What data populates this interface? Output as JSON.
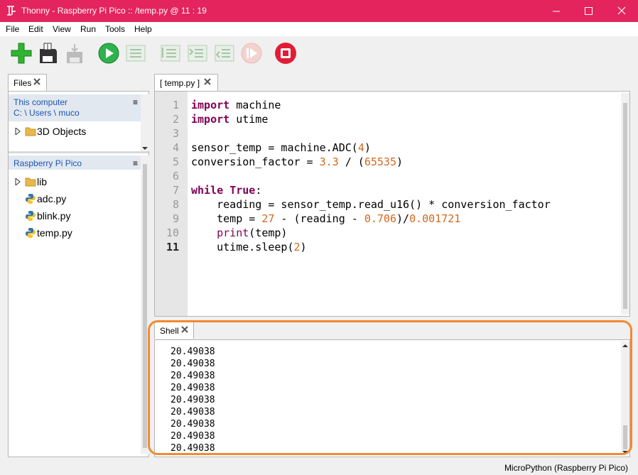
{
  "window": {
    "title": "Thonny  -  Raspberry Pi Pico :: /temp.py  @  11 : 19",
    "colors": {
      "titlebar": "#e3245d",
      "highlight": "#f28a30"
    }
  },
  "menu": [
    "File",
    "Edit",
    "View",
    "Run",
    "Tools",
    "Help"
  ],
  "toolbar": {
    "icons": [
      "new-file-icon",
      "save-icon",
      "load-icon",
      "run-icon",
      "debug-icon",
      "step-over-icon",
      "step-into-icon",
      "step-out-icon",
      "resume-icon",
      "stop-icon"
    ]
  },
  "files": {
    "tab_label": "Files",
    "this_computer": {
      "title": "This computer",
      "path": "C: \\ Users \\ muco",
      "items": [
        {
          "name": "3D Objects",
          "type": "folder"
        }
      ]
    },
    "pico": {
      "title": "Raspberry Pi Pico",
      "items": [
        {
          "name": "lib",
          "type": "folder"
        },
        {
          "name": "adc.py",
          "type": "python"
        },
        {
          "name": "blink.py",
          "type": "python"
        },
        {
          "name": "temp.py",
          "type": "python"
        }
      ]
    },
    "menu_glyph": "≡"
  },
  "editor": {
    "tab_label": "[ temp.py ]",
    "line_numbers": [
      "1",
      "2",
      "3",
      "4",
      "5",
      "6",
      "7",
      "8",
      "9",
      "10",
      "11"
    ],
    "lines": [
      "import machine",
      "import utime",
      "",
      "sensor_temp = machine.ADC(4)",
      "conversion_factor = 3.3 / (65535)",
      "",
      "while True:",
      "    reading = sensor_temp.read_u16() * conversion_factor",
      "    temp = 27 - (reading - 0.706)/0.001721",
      "    print(temp)",
      "    utime.sleep(2)"
    ]
  },
  "shell": {
    "tab_label": "Shell",
    "output": [
      "20.49038",
      "20.49038",
      "20.49038",
      "20.49038",
      "20.49038",
      "20.49038",
      "20.49038",
      "20.49038",
      "20.49038"
    ]
  },
  "status": "MicroPython (Raspberry Pi Pico)"
}
